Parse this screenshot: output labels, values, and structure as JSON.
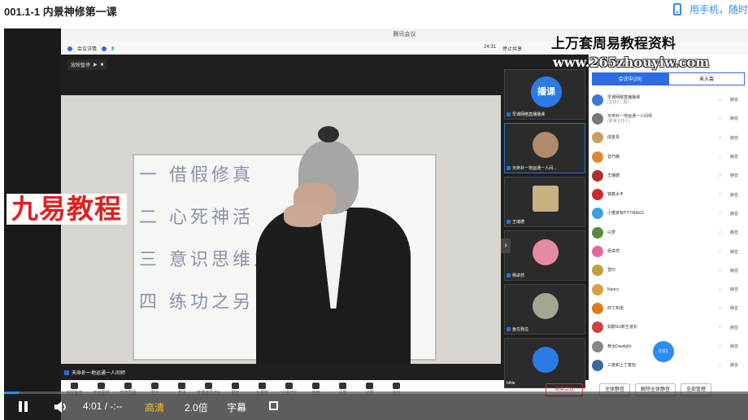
{
  "page": {
    "title": "001.1-1 内景神修第一课",
    "mobile_link": "用手机，随时"
  },
  "meeting": {
    "window_title": "腾讯会议",
    "info_label": "会议详情",
    "timer": "24:31",
    "share_label": "停止共享",
    "share_chip": "放映暂停",
    "speaker": "天命补一地运通一人间师",
    "tag_bar_left": "语音中心"
  },
  "watermark": {
    "left": "九易教程",
    "right_line1": "上万套周易教程资料",
    "right_line2": "www.265zhouyiw.com"
  },
  "board_lines": [
    "一 借假修真",
    "二 心死神活",
    "三 意识思维之",
    "四 练功之另"
  ],
  "thumbnails": [
    {
      "name": "早课网络直播播课",
      "label": "播课"
    },
    {
      "name": "天命补一地运通一人间..."
    },
    {
      "name": "王瑞德"
    },
    {
      "name": "杨卓然"
    },
    {
      "name": "鱼在我這"
    },
    {
      "name": "bihle"
    }
  ],
  "panel": {
    "tabs": [
      "会议中(29)",
      "未入会"
    ],
    "participants": [
      {
        "name": "早课网络直播播课",
        "sub": "(主持人, 我)",
        "color": "#3a7bd5",
        "mute": "静音"
      },
      {
        "name": "天命补一地运通一人间师",
        "sub": "(联席主持人)",
        "color": "#777",
        "mute": "静音"
      },
      {
        "name": "成金贵",
        "sub": "",
        "color": "#c9a060",
        "mute": "静音"
      },
      {
        "name": "曾巧娥",
        "sub": "",
        "color": "#d9883a",
        "mute": "静音"
      },
      {
        "name": "王瑞德",
        "sub": "",
        "color": "#b03030",
        "mute": "静音"
      },
      {
        "name": "锦鑫太平",
        "sub": "",
        "color": "#cc2a2a",
        "mute": "静音"
      },
      {
        "name": "小橙家有PY7HbE62",
        "sub": "",
        "color": "#3aa0e0",
        "mute": "静音"
      },
      {
        "name": "兴梦",
        "sub": "",
        "color": "#5a8a3a",
        "mute": "静音"
      },
      {
        "name": "杨卓然",
        "sub": "",
        "color": "#e06aa0",
        "mute": "静音"
      },
      {
        "name": "雪印",
        "sub": "",
        "color": "#c0a040",
        "mute": "静音"
      },
      {
        "name": "Nancy",
        "sub": "",
        "color": "#d6a040",
        "mute": "静音"
      },
      {
        "name": "四丁知道",
        "sub": "",
        "color": "#e07a20",
        "mute": "静音"
      },
      {
        "name": "如鹏SU新王道长",
        "sub": "",
        "color": "#d04040",
        "mute": "静音"
      },
      {
        "name": "黄汝Dawlight",
        "sub": "",
        "color": "#888",
        "mute": "静音"
      },
      {
        "name": "三度和上丁宽旭",
        "sub": "",
        "color": "#3a6a9a",
        "mute": "静音"
      }
    ],
    "buttons": [
      "全体静音",
      "解除全体静音",
      "全部管理"
    ]
  },
  "meeting_toolbar": [
    "解除静音",
    "开启视频",
    "共享屏幕",
    "安全",
    "邀请",
    "管理成员(29)",
    "聊天",
    "云录制",
    "分组讨论",
    "应用",
    "设置",
    "记录",
    "会议"
  ],
  "leave_button": "结束会议",
  "badge": "0:01",
  "player": {
    "time": "4:01 / -:--",
    "quality": "高清",
    "speed": "2.0倍",
    "subtitle": "字幕",
    "progress": 0.02
  }
}
